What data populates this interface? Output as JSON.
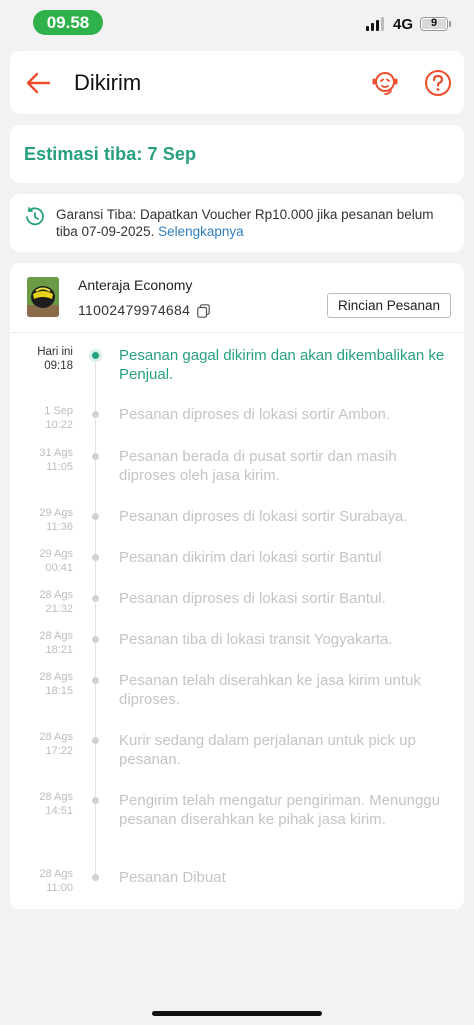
{
  "status_bar": {
    "time": "09.58",
    "network": "4G",
    "battery": "9",
    "battery_level": 0.09
  },
  "header": {
    "title": "Dikirim",
    "back_icon": "arrow-left-icon",
    "support_icon": "customer-service-icon",
    "help_icon": "question-icon"
  },
  "estimate": {
    "text": "Estimasi tiba: 7 Sep"
  },
  "guarantee": {
    "text": "Garansi Tiba: Dapatkan Voucher Rp10.000 jika pesanan belum tiba 07-09-2025. ",
    "link": "Selengkapnya"
  },
  "shipment": {
    "courier": "Anteraja Economy",
    "tracking_number": "11002479974684",
    "detail_button": "Rincian Pesanan"
  },
  "timeline": [
    {
      "date": "Hari ini",
      "time": "09:18",
      "text": "Pesanan gagal dikirim dan akan dikembalikan ke Penjual.",
      "active": true
    },
    {
      "date": "1 Sep",
      "time": "10:22",
      "text": "Pesanan diproses di lokasi sortir  Ambon."
    },
    {
      "date": "31 Ags",
      "time": "11:05",
      "text": "Pesanan berada di pusat sortir dan masih diproses oleh jasa kirim."
    },
    {
      "date": "29 Ags",
      "time": "11:36",
      "text": "Pesanan diproses di lokasi sortir  Surabaya."
    },
    {
      "date": "29 Ags",
      "time": "00:41",
      "text": "Pesanan dikirim dari lokasi sortir  Bantul"
    },
    {
      "date": "28 Ags",
      "time": "21:32",
      "text": "Pesanan diproses di lokasi sortir  Bantul."
    },
    {
      "date": "28 Ags",
      "time": "18:21",
      "text": "Pesanan tiba di lokasi transit  Yogyakarta."
    },
    {
      "date": "28 Ags",
      "time": "18:15",
      "text": "Pesanan telah diserahkan ke jasa kirim untuk diproses."
    },
    {
      "date": "28 Ags",
      "time": "17:22",
      "text": "Kurir sedang dalam perjalanan untuk pick up pesanan."
    },
    {
      "date": "28 Ags",
      "time": "14:51",
      "text": "Pengirim telah mengatur pengiriman. Menunggu pesanan diserahkan ke pihak jasa kirim."
    },
    {
      "date": "28 Ags",
      "time": "11:00",
      "text": "Pesanan Dibuat"
    }
  ],
  "colors": {
    "accent": "#26a07f",
    "brand": "#ee4d2d",
    "link": "#2f7fc1",
    "status_pill": "#2fb24c"
  }
}
